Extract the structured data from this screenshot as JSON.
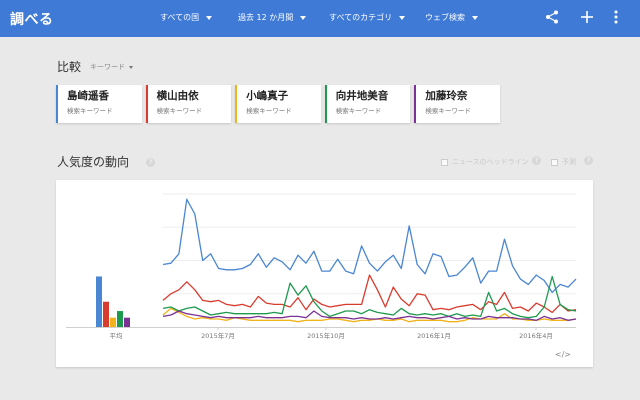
{
  "header": {
    "title": "調べる",
    "filters": [
      {
        "label": "すべての国"
      },
      {
        "label": "過去 12 か月間"
      },
      {
        "label": "すべてのカテゴリ"
      },
      {
        "label": "ウェブ検索"
      }
    ],
    "icons": [
      "share-icon",
      "add-icon",
      "more-vert-icon"
    ]
  },
  "compare": {
    "title": "比較",
    "dropdown_label": "キーワード",
    "terms": [
      {
        "name": "島崎遥香",
        "type": "検索キーワード",
        "color": "#4a86d2"
      },
      {
        "name": "横山由依",
        "type": "検索キーワード",
        "color": "#d93c2f"
      },
      {
        "name": "小嶋真子",
        "type": "検索キーワード",
        "color": "#f1b31c"
      },
      {
        "name": "向井地美音",
        "type": "検索キーワード",
        "color": "#1e9a4f"
      },
      {
        "name": "加藤玲奈",
        "type": "検索キーワード",
        "color": "#7b3294"
      }
    ]
  },
  "trend": {
    "title": "人気度の動向",
    "help": "?",
    "news_headlines_label": "ニュースのヘッドライン",
    "forecast_label": "予測"
  },
  "chart_data": {
    "type": "line",
    "x_tick_labels": [
      "2015年7月",
      "2015年10月",
      "2016年1月",
      "2016年4月"
    ],
    "average_label": "平均",
    "y_range": [
      0,
      100
    ],
    "grid": true,
    "averages": [
      {
        "color": "#4a86d2",
        "value": 38
      },
      {
        "color": "#d93c2f",
        "value": 19
      },
      {
        "color": "#f1b31c",
        "value": 7
      },
      {
        "color": "#1e9a4f",
        "value": 12
      },
      {
        "color": "#7b3294",
        "value": 7
      }
    ],
    "series": [
      {
        "color": "#4a86d2",
        "values": [
          47,
          48,
          55,
          96,
          85,
          50,
          55,
          44,
          43,
          43,
          44,
          47,
          55,
          45,
          52,
          49,
          43,
          54,
          48,
          57,
          42,
          42,
          51,
          42,
          40,
          61,
          48,
          42,
          49,
          54,
          44,
          76,
          47,
          40,
          55,
          53,
          38,
          39,
          45,
          52,
          33,
          42,
          42,
          66,
          46,
          36,
          32,
          39,
          35,
          26,
          32,
          30,
          36
        ]
      },
      {
        "color": "#d93c2f",
        "values": [
          20,
          25,
          28,
          34,
          28,
          20,
          19,
          20,
          17,
          16,
          17,
          15,
          23,
          18,
          17,
          17,
          15,
          22,
          13,
          21,
          17,
          15,
          16,
          17,
          17,
          17,
          39,
          28,
          15,
          30,
          21,
          16,
          25,
          24,
          13,
          14,
          13,
          15,
          16,
          17,
          13,
          19,
          17,
          26,
          14,
          15,
          12,
          18,
          15,
          11,
          17,
          12,
          13
        ]
      },
      {
        "color": "#f1b31c",
        "values": [
          9,
          14,
          11,
          8,
          6,
          7,
          6,
          6,
          5,
          7,
          6,
          5,
          5,
          5,
          5,
          5,
          5,
          4,
          5,
          5,
          5,
          6,
          6,
          5,
          4,
          5,
          5,
          6,
          5,
          5,
          6,
          4,
          5,
          5,
          5,
          5,
          4,
          4,
          5,
          7,
          6,
          6,
          6,
          10,
          6,
          6,
          5,
          5,
          6,
          5,
          5,
          5,
          6
        ]
      },
      {
        "color": "#1e9a4f",
        "values": [
          14,
          15,
          12,
          14,
          15,
          12,
          9,
          10,
          11,
          10,
          10,
          10,
          10,
          10,
          11,
          10,
          33,
          24,
          31,
          19,
          12,
          8,
          10,
          12,
          12,
          10,
          13,
          11,
          10,
          9,
          14,
          10,
          9,
          10,
          9,
          10,
          8,
          10,
          8,
          9,
          8,
          26,
          12,
          14,
          10,
          8,
          7,
          8,
          15,
          38,
          17,
          13,
          12
        ]
      },
      {
        "color": "#7b3294",
        "values": [
          8,
          9,
          12,
          10,
          9,
          8,
          7,
          8,
          7,
          7,
          7,
          7,
          8,
          7,
          7,
          7,
          8,
          8,
          7,
          12,
          8,
          7,
          7,
          7,
          6,
          7,
          6,
          6,
          7,
          6,
          7,
          8,
          7,
          7,
          6,
          7,
          8,
          6,
          7,
          6,
          6,
          8,
          7,
          7,
          7,
          6,
          6,
          5,
          8,
          6,
          7,
          5,
          6
        ]
      }
    ]
  }
}
